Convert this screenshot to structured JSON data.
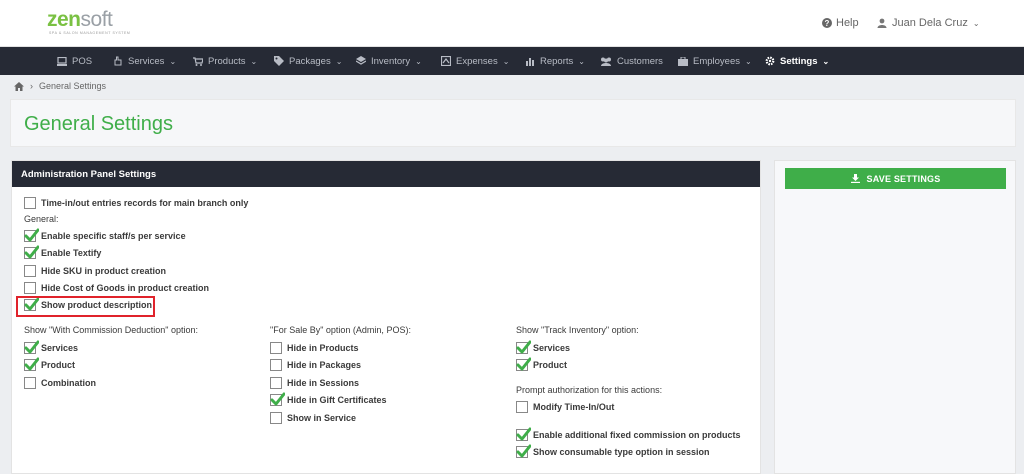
{
  "brand": {
    "logo_zen": "zen",
    "logo_soft": "soft",
    "logo_tagline": "SPA & SALON MANAGEMENT SYSTEM"
  },
  "header": {
    "help_label": "Help",
    "user_name": "Juan Dela Cruz"
  },
  "nav": {
    "items": [
      {
        "label": "POS",
        "icon": "pos-icon"
      },
      {
        "label": "Services",
        "icon": "hand-icon"
      },
      {
        "label": "Products",
        "icon": "cart-icon"
      },
      {
        "label": "Packages",
        "icon": "tag-icon"
      },
      {
        "label": "Inventory",
        "icon": "inventory-icon"
      },
      {
        "label": "Expenses",
        "icon": "expenses-icon"
      },
      {
        "label": "Reports",
        "icon": "bar-chart-icon"
      },
      {
        "label": "Customers",
        "icon": "users-icon"
      },
      {
        "label": "Employees",
        "icon": "briefcase-icon"
      },
      {
        "label": "Settings",
        "icon": "gear-icon"
      }
    ]
  },
  "breadcrumb": {
    "current": "General Settings"
  },
  "page": {
    "title": "General Settings"
  },
  "panel": {
    "title": "Administration Panel Settings"
  },
  "settings": {
    "main_branch": "Time-in/out entries records for main branch only",
    "general_label": "General:",
    "general": [
      {
        "label": "Enable specific staff/s per service",
        "checked": true
      },
      {
        "label": "Enable Textify",
        "checked": true
      },
      {
        "label": "Hide SKU in product creation",
        "checked": false
      },
      {
        "label": "Hide Cost of Goods in product creation",
        "checked": false
      },
      {
        "label": "Show product description",
        "checked": true
      }
    ],
    "commission_label": "Show \"With Commission Deduction\" option:",
    "commission": [
      {
        "label": "Services",
        "checked": true
      },
      {
        "label": "Product",
        "checked": true
      },
      {
        "label": "Combination",
        "checked": false
      }
    ],
    "forsale_label": "\"For Sale By\" option (Admin, POS):",
    "forsale": [
      {
        "label": "Hide in Products",
        "checked": false
      },
      {
        "label": "Hide in Packages",
        "checked": false
      },
      {
        "label": "Hide in Sessions",
        "checked": false
      },
      {
        "label": "Hide in Gift Certificates",
        "checked": true
      },
      {
        "label": "Show in Service",
        "checked": false
      }
    ],
    "track_label": "Show \"Track Inventory\" option:",
    "track": [
      {
        "label": "Services",
        "checked": true
      },
      {
        "label": "Product",
        "checked": true
      }
    ],
    "prompt_label": "Prompt authorization for this actions:",
    "prompt": [
      {
        "label": "Modify Time-In/Out",
        "checked": false
      }
    ],
    "extra": [
      {
        "label": "Enable additional fixed commission on products",
        "checked": true
      },
      {
        "label": "Show consumable type option in session",
        "checked": true
      }
    ]
  },
  "actions": {
    "save_label": "SAVE SETTINGS"
  },
  "colors": {
    "accent_green": "#3fae49",
    "nav_dark": "#262a35",
    "highlight_red": "#e0232b"
  }
}
